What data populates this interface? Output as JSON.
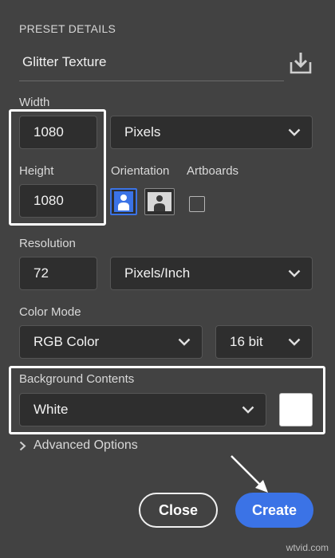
{
  "preset": {
    "section_title": "PRESET DETAILS",
    "name": "Glitter Texture",
    "save_icon": "save-preset-icon"
  },
  "width": {
    "label": "Width",
    "value": "1080",
    "unit": "Pixels"
  },
  "height": {
    "label": "Height",
    "value": "1080"
  },
  "orientation": {
    "label": "Orientation",
    "selected": "portrait"
  },
  "artboards": {
    "label": "Artboards",
    "checked": false
  },
  "resolution": {
    "label": "Resolution",
    "value": "72",
    "unit": "Pixels/Inch"
  },
  "color_mode": {
    "label": "Color Mode",
    "mode": "RGB Color",
    "depth": "16 bit"
  },
  "background": {
    "label": "Background Contents",
    "value": "White",
    "swatch_color": "#ffffff"
  },
  "advanced": {
    "label": "Advanced Options"
  },
  "buttons": {
    "close": "Close",
    "create": "Create"
  },
  "watermark": "wtvid.com",
  "colors": {
    "accent": "#3b73e6",
    "panel": "#424242",
    "field": "#2e2e2e"
  }
}
